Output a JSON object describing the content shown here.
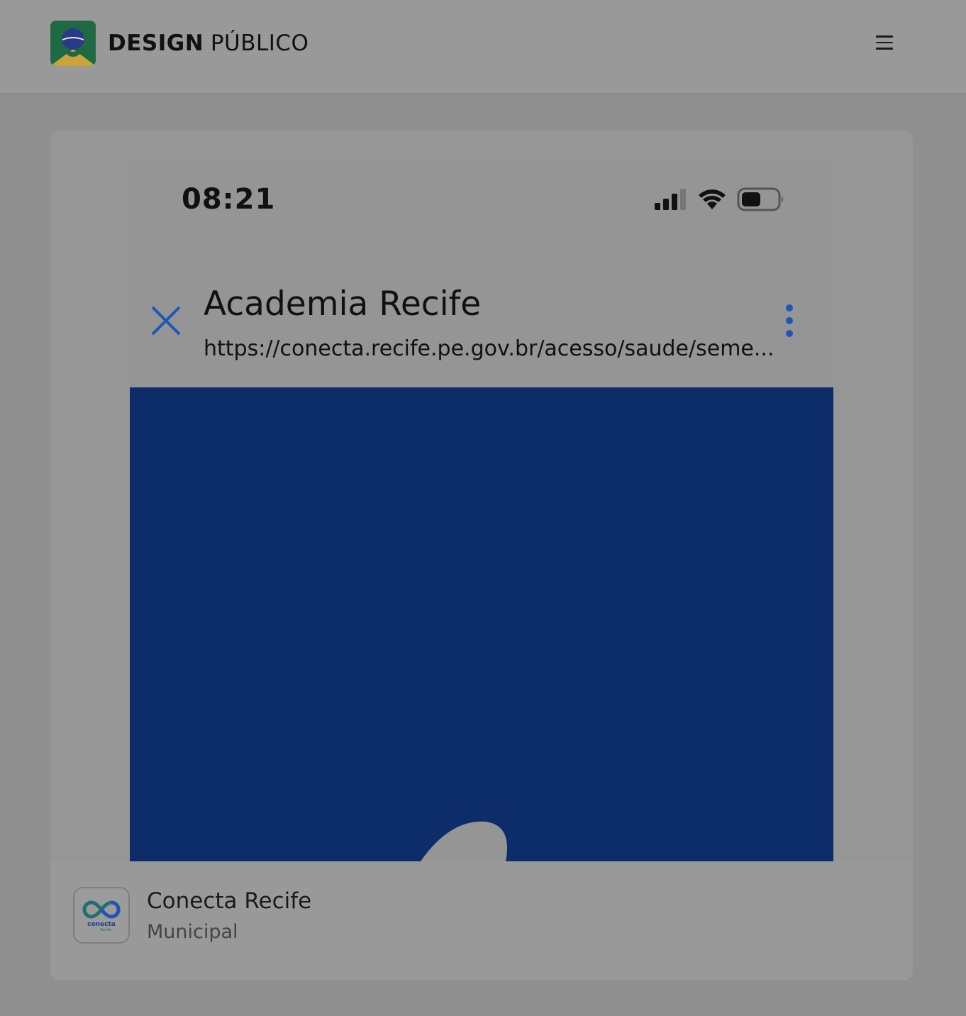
{
  "header": {
    "brand_bold": "DESIGN",
    "brand_light": "PÚBLICO",
    "menu_icon": "hamburger-menu-icon"
  },
  "phone_screenshot": {
    "status_time": "08:21",
    "status_icons": [
      "cellular-signal-icon",
      "wifi-icon",
      "battery-icon"
    ],
    "app_bar": {
      "title": "Academia Recife",
      "url": "https://conecta.recife.pe.gov.br/acesso/saude/seme...",
      "close_icon": "close-icon",
      "more_icon": "more-vertical-icon"
    },
    "webview_background": "#0c2d69"
  },
  "app_info": {
    "name": "Conecta Recife",
    "category": "Municipal",
    "icon_text": "conecta",
    "icon_subtext": "Recife"
  },
  "colors": {
    "accent_blue": "#1e56b7",
    "webview_navy": "#0c2d69",
    "logo_green": "#1f6a45",
    "logo_gold": "#c9a43a",
    "logo_navy": "#2b3a86"
  }
}
